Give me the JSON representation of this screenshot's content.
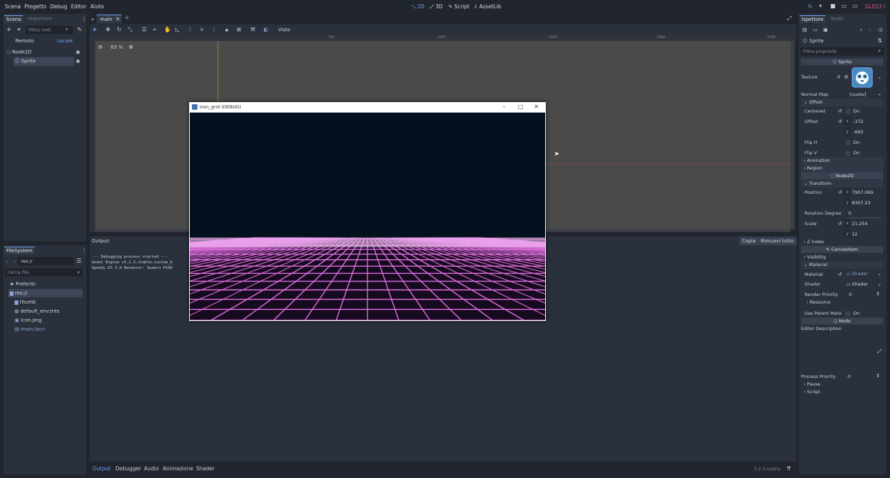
{
  "menubar": {
    "menus": [
      "Scena",
      "Progetto",
      "Debug",
      "Editor",
      "Aiuto"
    ],
    "modes": [
      "2D",
      "3D",
      "Script",
      "AssetLib"
    ],
    "renderer": "GLES3"
  },
  "scene_panel": {
    "tabs": [
      "Scena",
      "Importare"
    ],
    "filter_placeholder": "Filtra nodi",
    "remote_label": "Remoto",
    "local_label": "Locale",
    "tree": [
      {
        "name": "Node2D"
      },
      {
        "name": "Sprite"
      }
    ]
  },
  "filesystem_panel": {
    "tab": "FileSystem",
    "path": "res://",
    "search_placeholder": "Cerca file",
    "favorites": "Preferiti:",
    "items": [
      "res://",
      "thumb",
      "default_env.tres",
      "icon.png",
      "main.tscn"
    ]
  },
  "editor": {
    "scene_tab": "main",
    "view_menu": "Vista",
    "zoom": "63 %",
    "ruler_marks": [
      "500",
      "1000",
      "1500",
      "2000",
      "2500"
    ]
  },
  "debug_window": {
    "title": "tron_grid (DEBUG)",
    "sky_color": "#03111f",
    "grid_color": "#e070e0"
  },
  "output_panel": {
    "title": "Output:",
    "copy_label": "Copia",
    "clear_label": "Rimuovi tutto",
    "lines": [
      "--- Debugging process started ---",
      "Godot Engine v3.2.3.stable.custom_b",
      "OpenGL ES 3.0 Renderer: Quadro P100"
    ]
  },
  "bottom_bar": {
    "tabs": [
      "Output",
      "Debugger",
      "Audio",
      "Animazione",
      "Shader"
    ],
    "version": "3.2.3.stable"
  },
  "inspector": {
    "tabs": [
      "Ispettore",
      "Nodo"
    ],
    "node_type": "Sprite",
    "filter_placeholder": "Filtra proprietà",
    "class_header": "Sprite",
    "texture_label": "Texture",
    "normal_map_label": "Normal Map",
    "normal_map_value": "[vuoto]",
    "offset_section": "Offset",
    "centered_label": "Centered",
    "on_label": "On",
    "offset_label": "Offset",
    "offset_x": "-372",
    "offset_y": "-692",
    "flip_h_label": "Flip H",
    "flip_v_label": "Flip V",
    "animation_section": "Animation",
    "region_section": "Region",
    "node2d_header": "Node2D",
    "transform_section": "Transform",
    "position_label": "Position",
    "position_x": "7907.069",
    "position_y": "8307.23",
    "rotation_label": "Rotation Degree",
    "rotation_value": "0",
    "scale_label": "Scale",
    "scale_x": "21.254",
    "scale_y": "12",
    "zindex_section": "Z Index",
    "canvasitem_header": "CanvasItem",
    "visibility_section": "Visibility",
    "material_section": "Material",
    "material_label": "Material",
    "material_value": "Shader",
    "shader_label": "Shader",
    "shader_value": "Shader",
    "render_priority_label": "Render Priority",
    "render_priority_value": "0",
    "resource_section": "Resource",
    "use_parent_label": "Use Parent Mate",
    "node_header": "Node",
    "editor_description_label": "Editor Description",
    "process_priority_label": "Process Priority",
    "process_priority_value": "0",
    "pause_section": "Pause",
    "script_section": "Script"
  },
  "colors": {
    "accent": "#6ea3f2",
    "background": "#20252e",
    "panel": "#2b313c",
    "viewport": "#4a4a4a",
    "renderer_badge": "#e05a7a"
  }
}
